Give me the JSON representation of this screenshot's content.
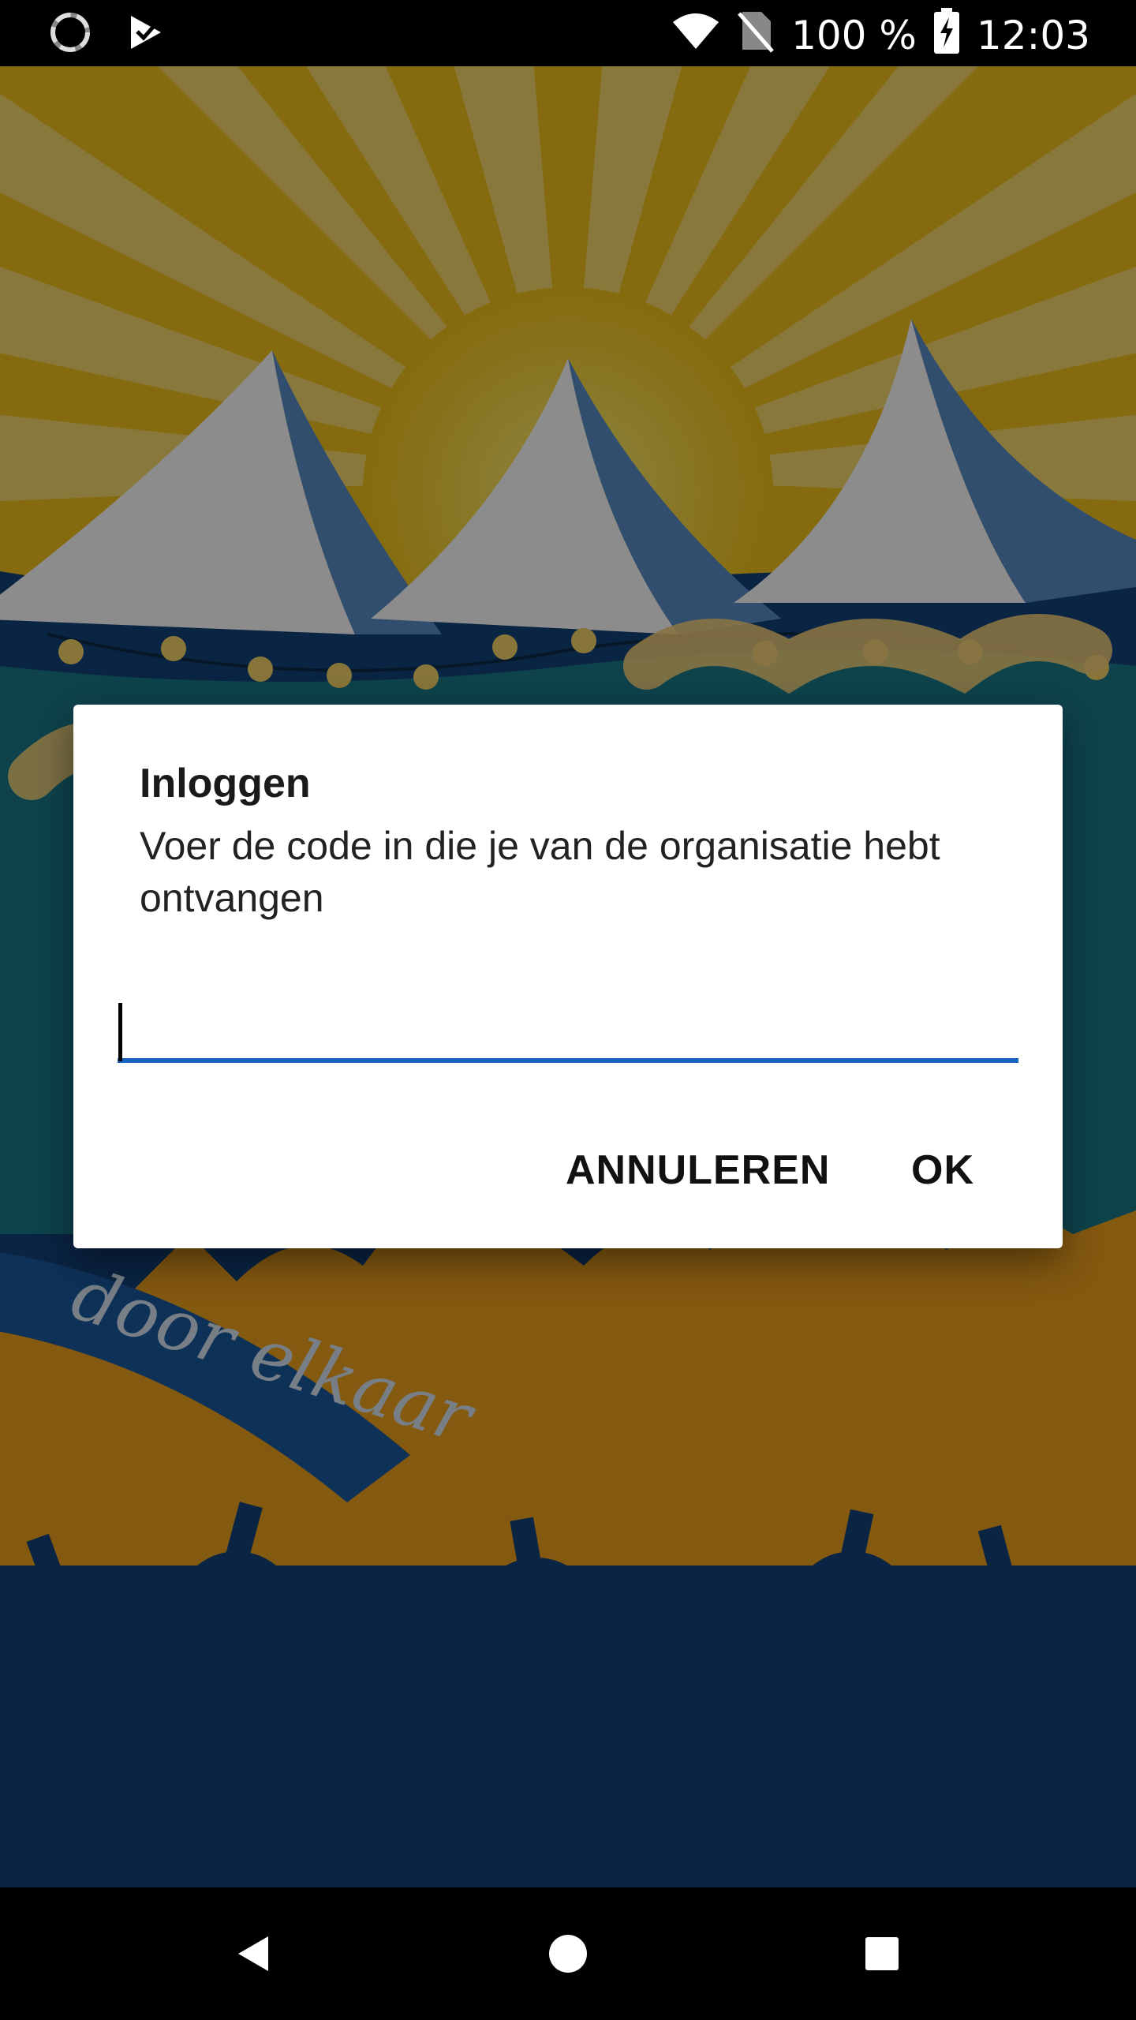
{
  "status_bar": {
    "battery_text": "100 %",
    "time": "12:03",
    "left_icons": [
      "loading-spinner-icon",
      "check-flag-icon"
    ],
    "right_icons": [
      "wifi-icon",
      "no-sim-icon",
      "battery-charging-icon"
    ]
  },
  "dialog": {
    "title": "Inloggen",
    "message": "Voer de code in die je van de organisatie hebt ontvangen",
    "input_value": "",
    "input_placeholder": "",
    "cancel_label": "ANNULEREN",
    "ok_label": "OK",
    "accent_color": "#1565c0"
  },
  "background": {
    "banner_text": "door elkaar",
    "colors": {
      "sun": "#f2c318",
      "ray": "#e8a21c",
      "teal": "#1a7a8a",
      "navy": "#13437a",
      "tent": "#ffffff",
      "crowd_orange": "#f0a31e"
    }
  },
  "nav_bar": {
    "icons": [
      "back-icon",
      "home-icon",
      "recents-icon"
    ]
  }
}
